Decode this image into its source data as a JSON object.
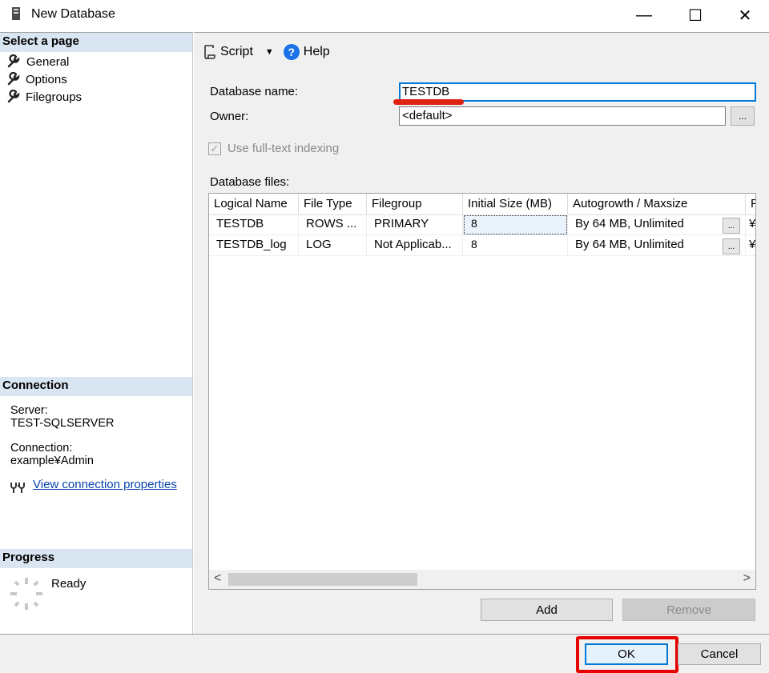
{
  "window": {
    "title": "New Database",
    "icon": "database-icon",
    "minimize": "—",
    "maximize": "☐",
    "close": "✕"
  },
  "left": {
    "select_page_header": "Select a page",
    "pages": [
      {
        "label": "General",
        "icon": "wrench-icon",
        "selected": true
      },
      {
        "label": "Options",
        "icon": "wrench-icon"
      },
      {
        "label": "Filegroups",
        "icon": "wrench-icon"
      }
    ],
    "connection_header": "Connection",
    "server_label": "Server:",
    "server_value": "TEST-SQLSERVER",
    "connection_label": "Connection:",
    "connection_value": "example¥Admin",
    "view_props_link": "View connection properties",
    "progress_header": "Progress",
    "progress_status": "Ready"
  },
  "toolbar": {
    "script_label": "Script",
    "help_label": "Help"
  },
  "form": {
    "db_name_label": "Database name:",
    "db_name_value": "TESTDB",
    "owner_label": "Owner:",
    "owner_value": "<default>",
    "owner_browse": "...",
    "fulltext_label": "Use full-text indexing",
    "fulltext_checked": true,
    "db_files_label": "Database files:"
  },
  "grid": {
    "columns": [
      "Logical Name",
      "File Type",
      "Filegroup",
      "Initial Size (MB)",
      "Autogrowth / Maxsize",
      "P"
    ],
    "rows": [
      {
        "logical_name": "TESTDB",
        "file_type": "ROWS ...",
        "filegroup": "PRIMARY",
        "initial_size": "8",
        "autogrowth": "By 64 MB, Unlimited",
        "extra": "¥"
      },
      {
        "logical_name": "TESTDB_log",
        "file_type": "LOG",
        "filegroup": "Not Applicab...",
        "initial_size": "8",
        "autogrowth": "By 64 MB, Unlimited",
        "extra": "¥"
      }
    ],
    "cell_browse": "...",
    "scroll_left": "<",
    "scroll_right": ">"
  },
  "buttons": {
    "add": "Add",
    "remove": "Remove",
    "ok": "OK",
    "cancel": "Cancel"
  },
  "colors": {
    "section_header_bg": "#d9e5f1",
    "focus_blue": "#0078d7",
    "highlight_red": "#e80000",
    "link_blue": "#0645ad"
  }
}
